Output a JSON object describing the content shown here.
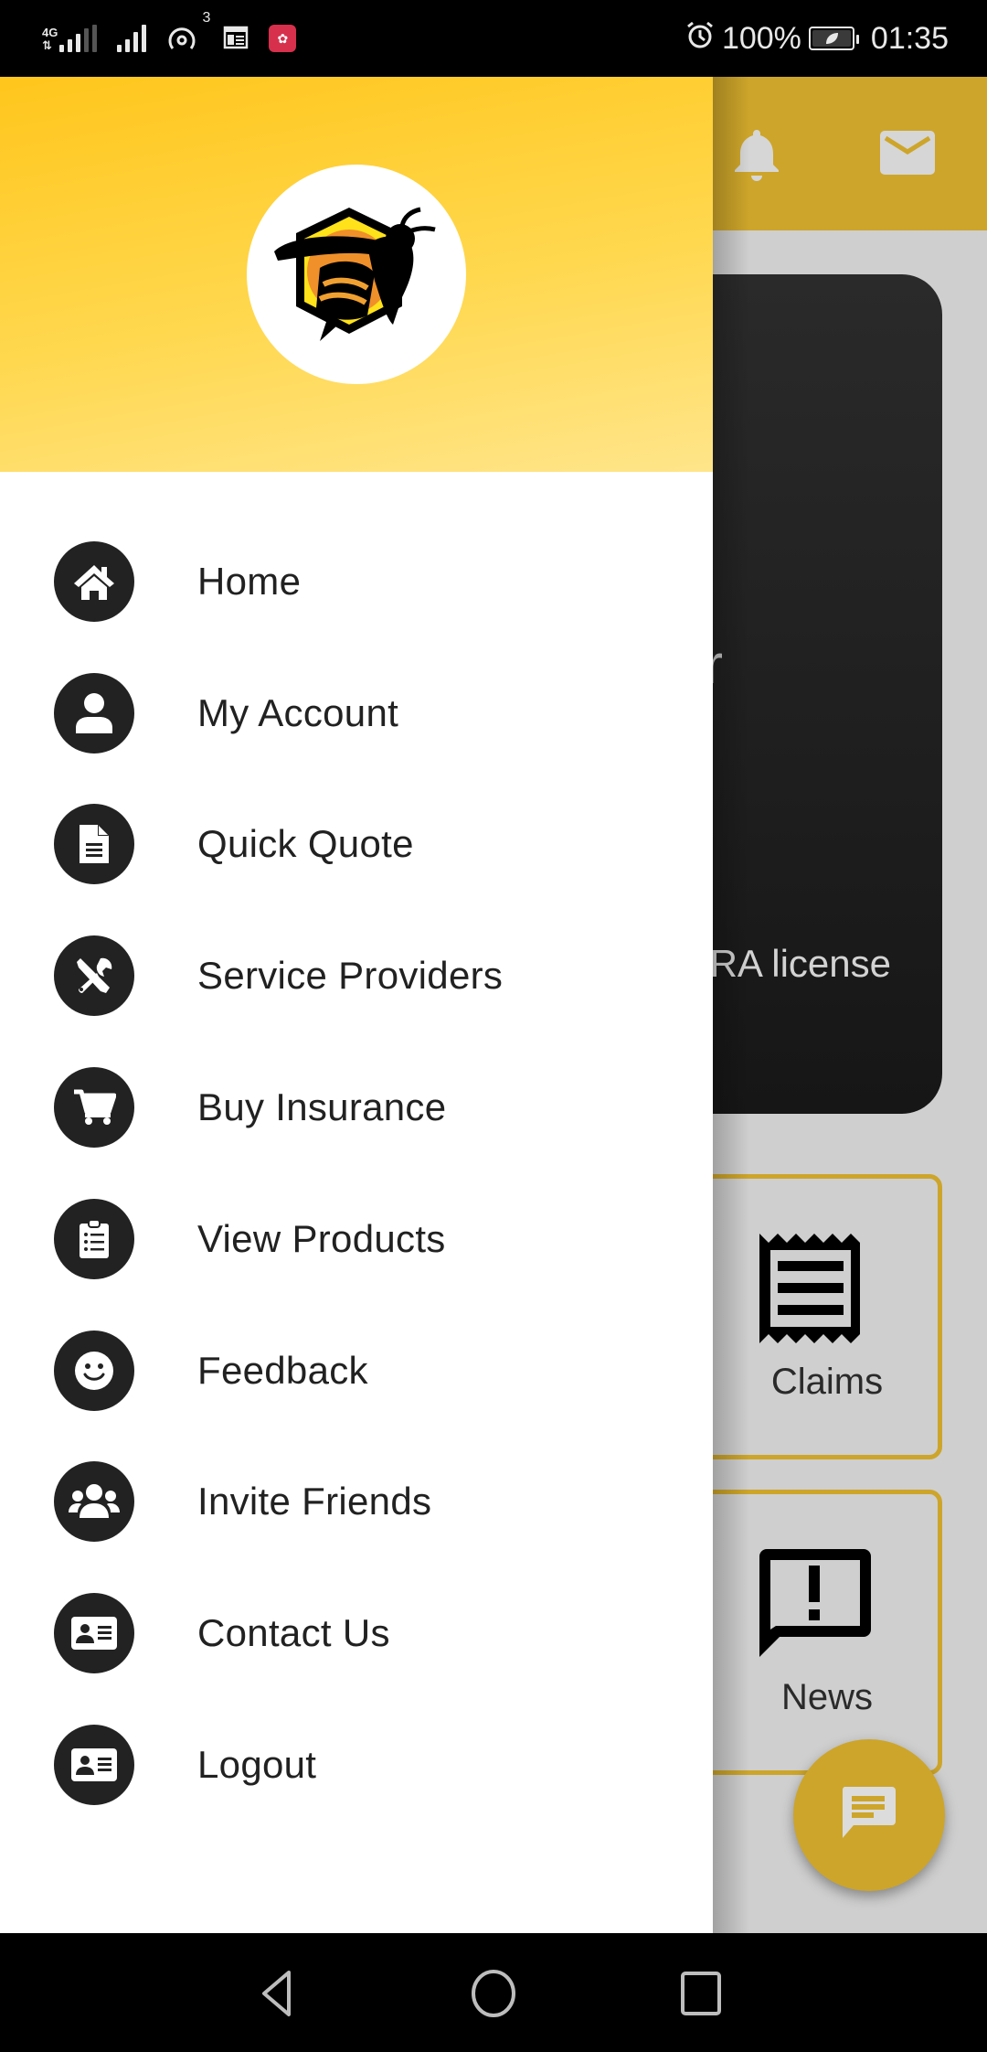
{
  "status_bar": {
    "network_type": "4G",
    "hotspot_count": "3",
    "battery_percent": "100%",
    "time": "01:35",
    "icons": [
      "signal-4g-icon",
      "signal-icon",
      "hotspot-icon",
      "calendar-icon",
      "huawei-app-icon",
      "alarm-icon",
      "battery-saver-icon"
    ]
  },
  "background_app": {
    "toolbar_icons": [
      "bell-icon",
      "mail-icon"
    ],
    "hero": {
      "title_fragment": "r",
      "subtitle_fragment": "RA license"
    },
    "tiles": [
      {
        "label": "Claims",
        "icon": "receipt-icon"
      },
      {
        "label": "News",
        "icon": "feedback-alert-icon"
      }
    ],
    "fab_icon": "chat-icon",
    "colors": {
      "accent": "#cda52a",
      "background": "#cfcfcf",
      "hero": "#1c1c1c"
    }
  },
  "drawer": {
    "header_logo": "bee-hexagon-logo",
    "colors": {
      "header_top": "#ffc61c",
      "header_bottom": "#ffe58a",
      "icon_circle": "#222222",
      "text": "#212121"
    },
    "items": [
      {
        "label": "Home",
        "icon": "home-icon"
      },
      {
        "label": "My Account",
        "icon": "person-icon"
      },
      {
        "label": "Quick Quote",
        "icon": "document-icon"
      },
      {
        "label": "Service Providers",
        "icon": "tools-icon"
      },
      {
        "label": "Buy Insurance",
        "icon": "cart-icon"
      },
      {
        "label": "View Products",
        "icon": "clipboard-list-icon"
      },
      {
        "label": "Feedback",
        "icon": "smile-icon"
      },
      {
        "label": "Invite Friends",
        "icon": "users-icon"
      },
      {
        "label": "Contact Us",
        "icon": "id-card-icon"
      },
      {
        "label": "Logout",
        "icon": "id-card-icon"
      }
    ]
  },
  "nav_bar": {
    "buttons": [
      "back",
      "home",
      "recents"
    ]
  }
}
